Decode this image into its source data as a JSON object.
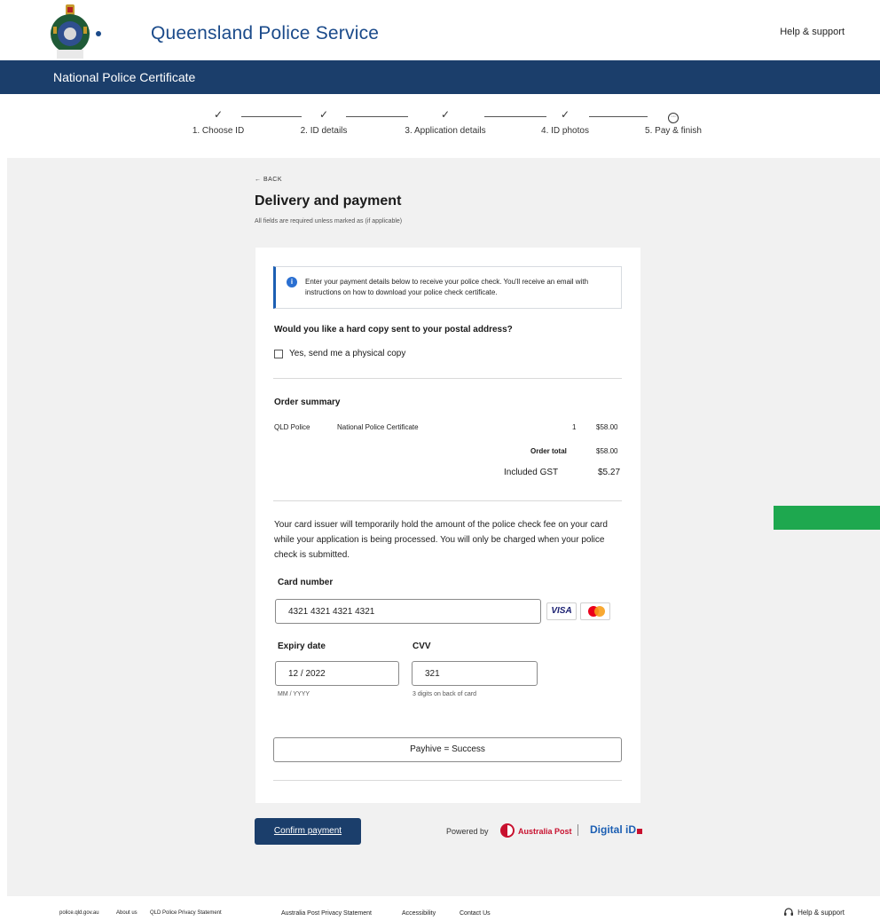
{
  "header": {
    "brand": "Queensland Police Service",
    "help": "Help & support"
  },
  "banner": {
    "title": "National Police Certificate"
  },
  "stepper": {
    "steps": [
      {
        "label": "1. Choose ID",
        "status": "done"
      },
      {
        "label": "2. ID details",
        "status": "done"
      },
      {
        "label": "3. Application details",
        "status": "done"
      },
      {
        "label": "4. ID photos",
        "status": "done"
      },
      {
        "label": "5. Pay & finish",
        "status": "current"
      }
    ]
  },
  "page": {
    "back": "← BACK",
    "title": "Delivery and payment",
    "subtitle": "All fields are required unless marked as (if applicable)"
  },
  "info": {
    "text": "Enter your payment details below to receive your police check. You'll receive an email with instructions on how to download your police check certificate."
  },
  "hardcopy": {
    "question": "Would you like a hard copy sent to your postal address?",
    "checkbox_label": "Yes, send me a physical copy",
    "checked": false
  },
  "order": {
    "title": "Order summary",
    "vendor": "QLD Police",
    "item": "National Police Certificate",
    "qty": "1",
    "price": "$58.00",
    "total_label": "Order total",
    "total": "$58.00",
    "gst_label": "Included GST",
    "gst": "$5.27"
  },
  "hold_text": "Your card issuer will temporarily hold the amount of the police check fee on your card while your application is being processed. You will only be charged when your police check is submitted.",
  "card": {
    "number_label": "Card number",
    "number": "4321 4321 4321 4321",
    "visa_label": "VISA",
    "expiry_label": "Expiry date",
    "expiry": "12 / 2022",
    "expiry_hint": "MM / YYYY",
    "cvv_label": "CVV",
    "cvv": "321",
    "cvv_hint": "3 digits on back of card"
  },
  "payhive": "Payhive = Success",
  "actions": {
    "confirm": "Confirm payment",
    "powered_by": "Powered by",
    "ap_name": "Australia Post",
    "digital_id": "Digital iD"
  },
  "colors": {
    "navy": "#1b3e6b",
    "info_blue": "#2a6fd1",
    "green": "#1ea84f",
    "ap_red": "#c8102e"
  },
  "footer": {
    "links": [
      "police.qld.gov.au",
      "About us",
      "QLD Police Privacy Statement",
      "Australia Post Privacy Statement",
      "Accessibility",
      "Contact Us"
    ],
    "help": "Help & support"
  }
}
